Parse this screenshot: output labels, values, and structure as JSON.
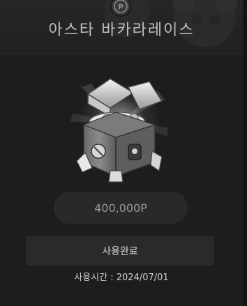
{
  "header": {
    "title": "아스타 바카라레이스",
    "coin_icon": "point-coin-icon",
    "coin_glyph": "P"
  },
  "reward": {
    "image_icon": "treasure-chest-icon",
    "price": "400,000P"
  },
  "action": {
    "status_label": "사용완료",
    "used_time": "사용시간 : 2024/07/01"
  },
  "colors": {
    "background": "#1c1c1c",
    "header": "#242424",
    "pill": "#292929",
    "button": "#2a2a2a",
    "text_muted": "#9a9a9a"
  }
}
